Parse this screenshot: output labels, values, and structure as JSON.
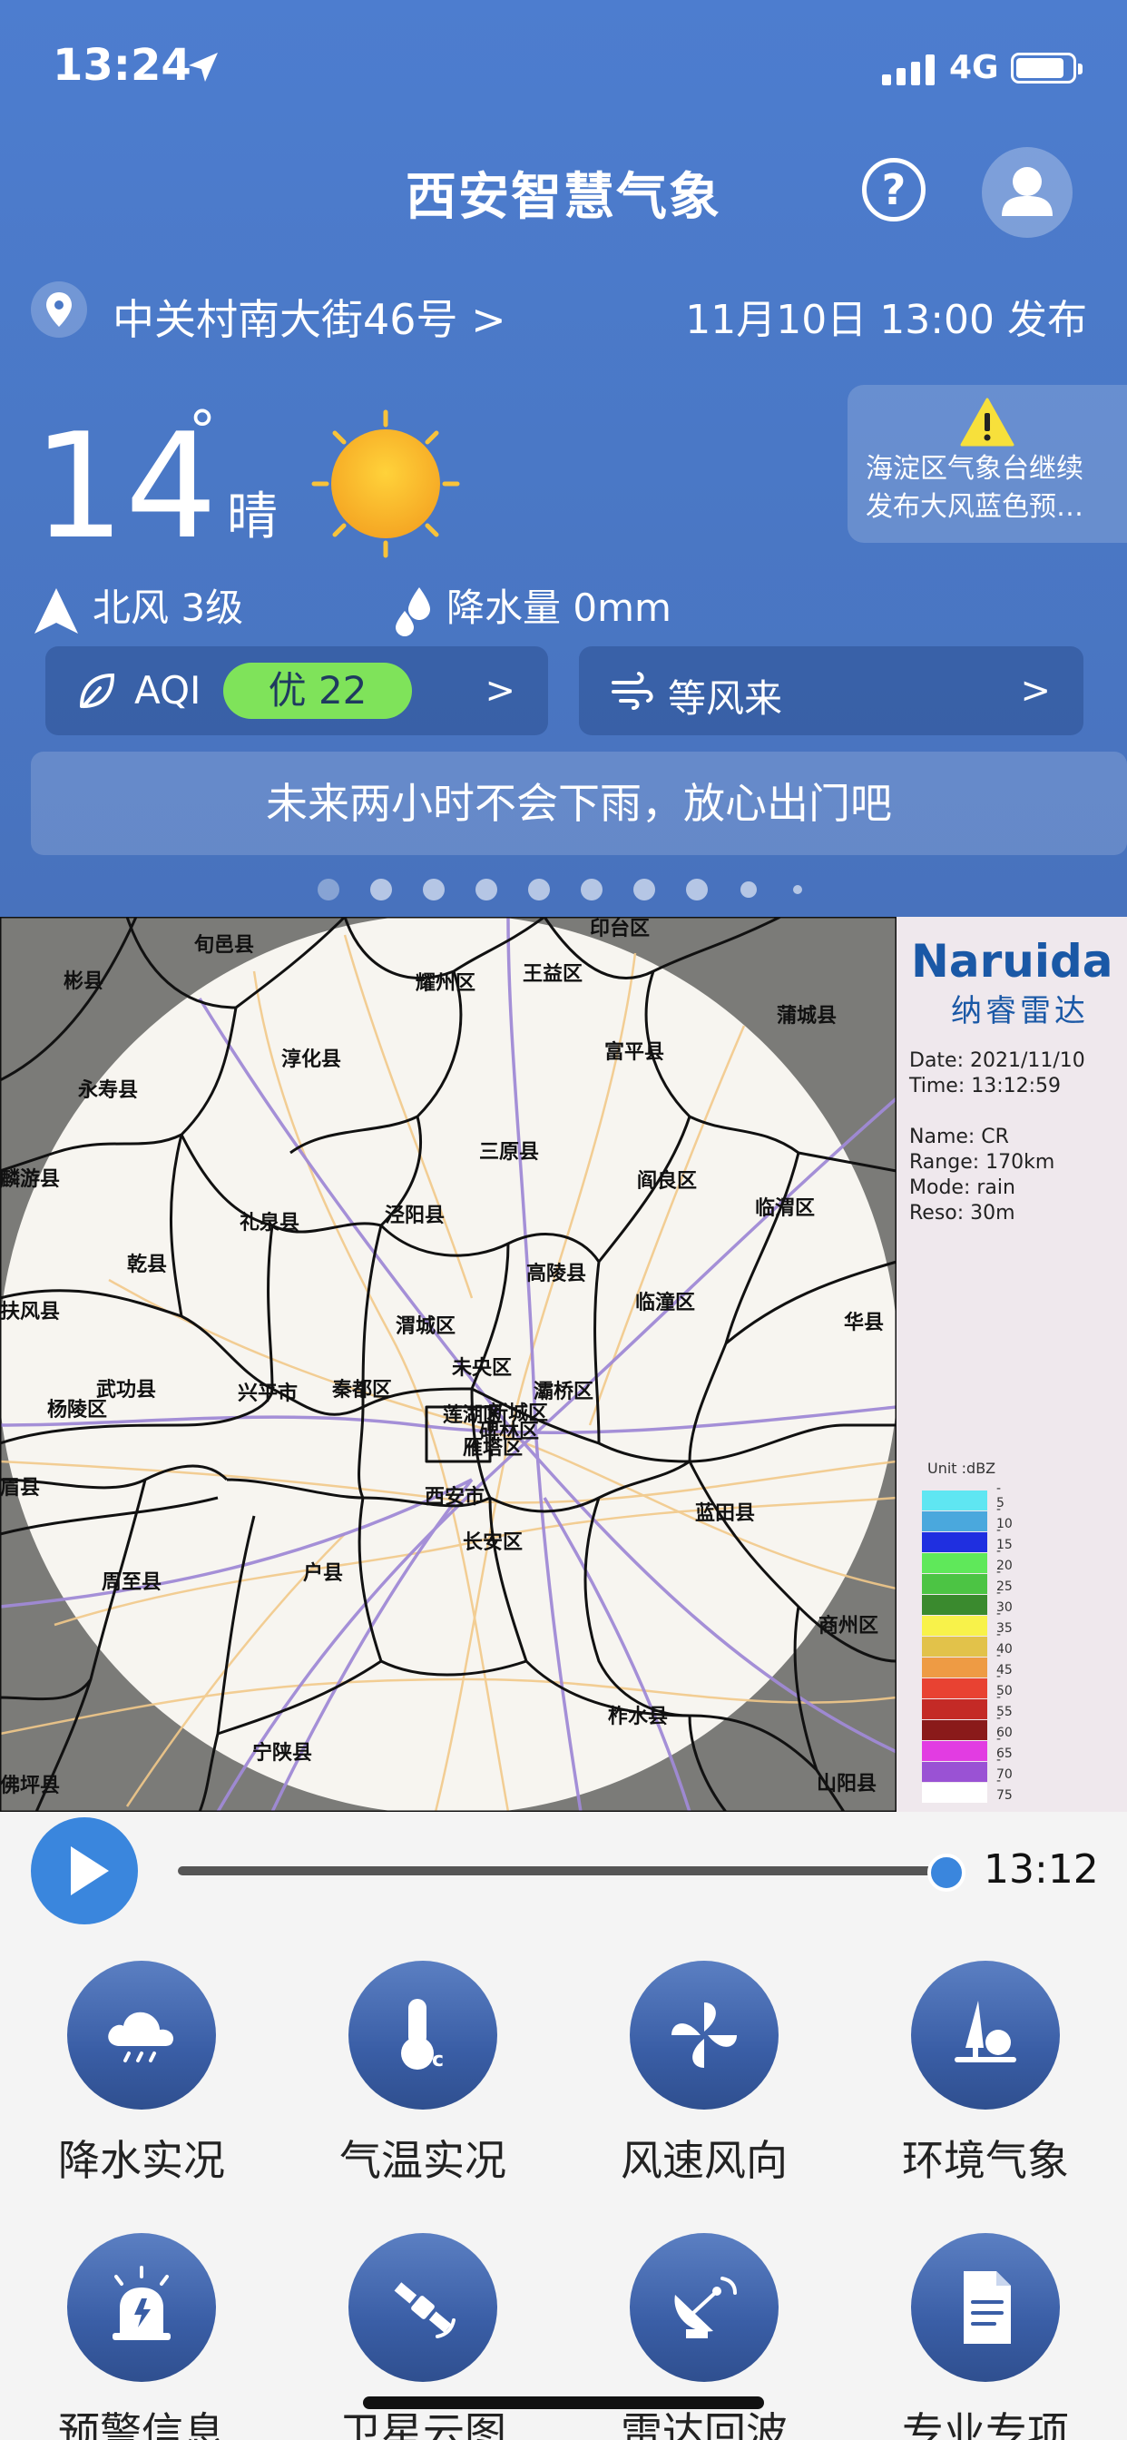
{
  "status": {
    "time": "13:24",
    "network": "4G"
  },
  "app": {
    "title": "西安智慧气象",
    "help": "?"
  },
  "location": {
    "address": "中关村南大街46号 >",
    "publish": "11月10日 13:00 发布"
  },
  "weather": {
    "temp": "14",
    "degree": "°",
    "condition": "晴",
    "wind": "北风 3级",
    "rain": "降水量 0mm"
  },
  "warning": {
    "text1": "海淀区气象台继续",
    "text2": "发布大风蓝色预…"
  },
  "aqi": {
    "label": "AQI",
    "badge": "优 22",
    "chev": ">"
  },
  "windcard": {
    "label": "等风来",
    "chev": ">"
  },
  "tip": "未来两小时不会下雨，放心出门吧",
  "radar": {
    "brand": "Naruida",
    "brand_cn": "纳睿雷达",
    "date": "Date: 2021/11/10",
    "time": "Time: 13:12:59",
    "name": "Name: CR",
    "range": "Range: 170km",
    "mode": "Mode: rain",
    "reso": "Reso: 30m",
    "unit": "Unit :dBZ",
    "legend": [
      {
        "v": "5",
        "c": "#5fe6f2"
      },
      {
        "v": "10",
        "c": "#4aa8dd"
      },
      {
        "v": "15",
        "c": "#1f2fe0"
      },
      {
        "v": "20",
        "c": "#5fe85a"
      },
      {
        "v": "25",
        "c": "#4cc444"
      },
      {
        "v": "30",
        "c": "#3a8a2e"
      },
      {
        "v": "35",
        "c": "#f8f24a"
      },
      {
        "v": "40",
        "c": "#e2c24a"
      },
      {
        "v": "45",
        "c": "#ee9b44"
      },
      {
        "v": "50",
        "c": "#e84232"
      },
      {
        "v": "55",
        "c": "#c42a26"
      },
      {
        "v": "60",
        "c": "#8a1a1a"
      },
      {
        "v": "65",
        "c": "#e23ce2"
      },
      {
        "v": "70",
        "c": "#9a52d4"
      },
      {
        "v": "75",
        "c": "#ffffff"
      }
    ],
    "labels": {
      "xunyi": "旬邑县",
      "binxian": "彬县",
      "yaozhou": "耀州区",
      "wangyi": "王益区",
      "yintai": "印台区",
      "pucheng": "蒲城县",
      "chunhua": "淳化县",
      "fuping": "富平县",
      "yongshou": "永寿县",
      "linyou": "麟游县",
      "sanyuan": "三原县",
      "yanliang": "阎良区",
      "liquan": "礼泉县",
      "jingyang": "泾阳县",
      "lintong_w": "临渭区",
      "qianxian": "乾县",
      "gaoling": "高陵县",
      "lintong": "临潼区",
      "fufeng": "扶风县",
      "weicheng": "渭城区",
      "huaxian": "华县",
      "weiyang": "未央区",
      "baqiao": "灞桥区",
      "wugong": "武功县",
      "xingping": "兴平市",
      "qindu": "秦都区",
      "yangling": "杨陵区",
      "lianhu": "莲湖区",
      "xincheng": "新城区",
      "beilin": "碑林区",
      "yanta": "雁塔区",
      "meixian": "眉县",
      "xian": "西安市",
      "lantian": "蓝田县",
      "zhouzhi": "周至县",
      "huxian": "户县",
      "changan": "长安区",
      "shangzhou": "商州区",
      "zhashui": "柞水县",
      "ningshan": "宁陕县",
      "foping": "佛坪县",
      "shanyang": "山阳县"
    }
  },
  "playback": {
    "time": "13:12"
  },
  "menu": [
    {
      "label": "降水实况"
    },
    {
      "label": "气温实况"
    },
    {
      "label": "风速风向"
    },
    {
      "label": "环境气象"
    },
    {
      "label": "预警信息"
    },
    {
      "label": "卫星云图"
    },
    {
      "label": "雷达回波"
    },
    {
      "label": "专业专项"
    }
  ]
}
